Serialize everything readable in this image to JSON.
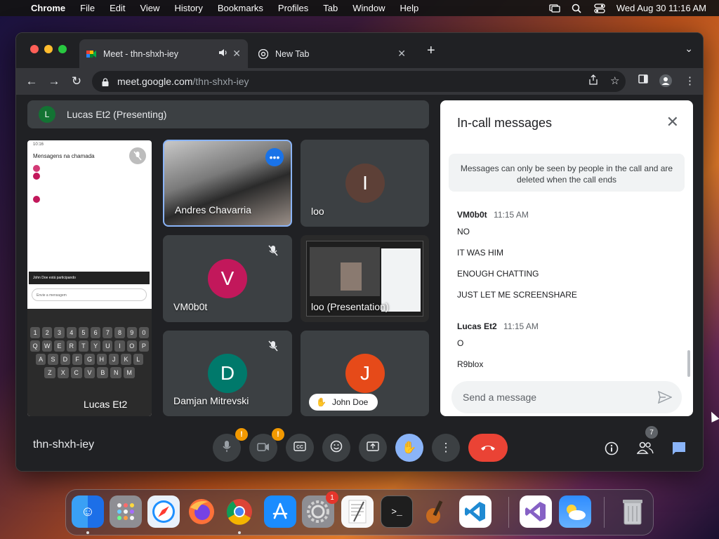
{
  "menubar": {
    "app": "Chrome",
    "items": [
      "File",
      "Edit",
      "View",
      "History",
      "Bookmarks",
      "Profiles",
      "Tab",
      "Window",
      "Help"
    ],
    "clock": "Wed Aug 30  11:16 AM"
  },
  "browser": {
    "tabs": [
      {
        "title": "Meet - thn-shxh-iey",
        "active": true
      },
      {
        "title": "New Tab",
        "active": false
      }
    ],
    "url_host": "meet.google.com",
    "url_path": "/thn-shxh-iey"
  },
  "meet": {
    "presenting_banner": {
      "initial": "L",
      "text": "Lucas Et2 (Presenting)"
    },
    "tiles": [
      {
        "name": "Andres Chavarria"
      },
      {
        "name": "loo",
        "initial": "I"
      },
      {
        "name": "VM0b0t",
        "initial": "V"
      },
      {
        "name": "loo (Presentation)"
      },
      {
        "name": "Damjan Mitrevski",
        "initial": "D"
      },
      {
        "name": "John Doe",
        "initial": "J"
      }
    ],
    "presenter_name": "Lucas Et2",
    "phone_screen": {
      "time": "10:16",
      "header": "Mensagens na chamada",
      "toast": "John Doe está participando",
      "compose_placeholder": "Envie a mensagem"
    },
    "keyboard_rows": [
      [
        "1",
        "2",
        "3",
        "4",
        "5",
        "6",
        "7",
        "8",
        "9",
        "0"
      ],
      [
        "Q",
        "W",
        "E",
        "R",
        "T",
        "Y",
        "U",
        "I",
        "O",
        "P"
      ],
      [
        "A",
        "S",
        "D",
        "F",
        "G",
        "H",
        "J",
        "K",
        "L"
      ],
      [
        "Z",
        "X",
        "C",
        "V",
        "B",
        "N",
        "M"
      ]
    ],
    "chat": {
      "title": "In-call messages",
      "notice": "Messages can only be seen by people in the call and are deleted when the call ends",
      "groups": [
        {
          "sender": "VM0b0t",
          "time": "11:15 AM",
          "messages": [
            "NO",
            "IT WAS HIM",
            "ENOUGH CHATTING",
            "JUST LET ME SCREENSHARE"
          ]
        },
        {
          "sender": "Lucas Et2",
          "time": "11:15 AM",
          "messages": [
            "O",
            "R9blox"
          ]
        }
      ],
      "input_placeholder": "Send a message"
    },
    "meeting_code": "thn-shxh-iey",
    "people_count": "7"
  },
  "dock": {
    "settings_badge": "1"
  },
  "colors": {
    "meet_bg": "#202124",
    "tile_bg": "#3c4043",
    "end_call": "#ea4335",
    "hand_raise": "#8ab4f8",
    "warning": "#f29900",
    "avatar_v": "#c2185b",
    "avatar_d": "#00796b",
    "avatar_j": "#e64a19",
    "avatar_i": "#5d4037"
  }
}
